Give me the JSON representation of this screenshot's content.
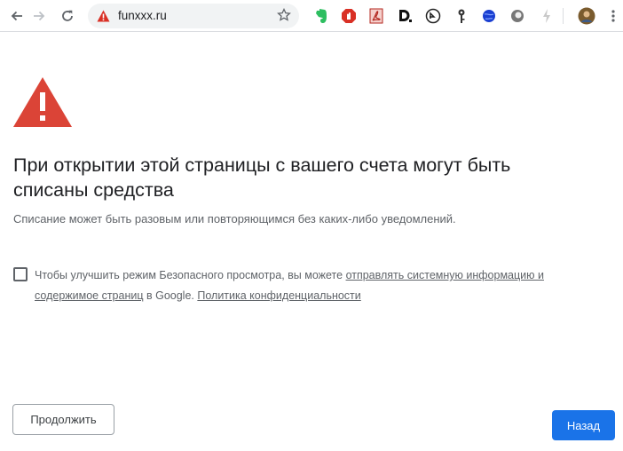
{
  "browser": {
    "url": "funxxx.ru",
    "colors": {
      "accent": "#1a73e8",
      "warning": "#db4437",
      "toolbar_bg": "#ffffff",
      "omnibox_bg": "#f1f3f4"
    },
    "toolbar_icons": [
      "back-arrow-icon",
      "forward-arrow-icon",
      "reload-icon",
      "warning-icon",
      "star-icon"
    ],
    "extensions": [
      {
        "name": "evernote-icon",
        "color": "#2dbe60"
      },
      {
        "name": "adblock-icon",
        "color": "#d93025"
      },
      {
        "name": "pdf-icon",
        "color": "#b3261e"
      },
      {
        "name": "dashlane-icon",
        "color": "#111111"
      },
      {
        "name": "grammarly-icon",
        "color": "#222222"
      },
      {
        "name": "key-icon",
        "color": "#333333"
      },
      {
        "name": "blue-globe-icon",
        "color": "#1a3fd1"
      },
      {
        "name": "gray-circle-icon",
        "color": "#777777"
      },
      {
        "name": "lightning-icon",
        "color": "#c9c9c9"
      },
      {
        "name": "profile-avatar-icon",
        "color": "#7a5b2e"
      }
    ]
  },
  "page": {
    "heading": "При открытии этой страницы с вашего счета могут быть списаны средства",
    "subtext": "Списание может быть разовым или повторяющимся без каких-либо уведомлений.",
    "report": {
      "checked": false,
      "prefix": "Чтобы улучшить режим Безопасного просмотра, вы можете ",
      "link1": "отправлять системную информацию и содержимое страниц",
      "middle": " в Google. ",
      "link2": "Политика конфиденциальности"
    },
    "buttons": {
      "continue": "Продолжить",
      "back": "Назад"
    }
  }
}
